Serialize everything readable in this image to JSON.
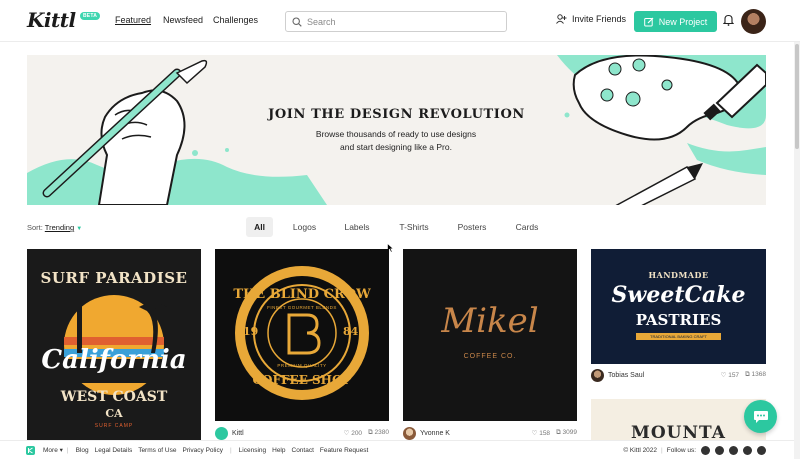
{
  "header": {
    "logo_text": "Kittl",
    "logo_badge": "BETA",
    "nav": [
      "Featured",
      "Newsfeed",
      "Challenges"
    ],
    "search_placeholder": "Search",
    "invite_label": "Invite Friends",
    "new_project_label": "New Project"
  },
  "banner": {
    "title": "JOIN THE DESIGN REVOLUTION",
    "subtitle_line1": "Browse thousands of ready to use designs",
    "subtitle_line2": "and start designing like a Pro.",
    "accent_color": "#8ee6cc"
  },
  "filters": {
    "sort_label": "Sort:",
    "sort_value": "Trending",
    "tabs": [
      "All",
      "Logos",
      "Labels",
      "T-Shirts",
      "Posters",
      "Cards"
    ],
    "active_tab": "All"
  },
  "cards": [
    {
      "art_title": "SURF PARADISE",
      "art_main": "California",
      "art_sub": "WEST COAST",
      "art_sub2": "CA",
      "art_foot": "SURF CAMP"
    },
    {
      "art_title": "THE BLIND CROW",
      "art_ring": "FINEST GOURMET BLENDS",
      "art_left": "19",
      "art_right": "84",
      "art_foot": "COFFEE SHOP",
      "art_mini": "PREMIUM QUALITY",
      "author": "Kittl",
      "likes": "200",
      "copies": "2380"
    },
    {
      "art_main": "Mikel",
      "art_sub": "COFFEE CO.",
      "author": "Yvonne K",
      "likes": "158",
      "copies": "3099"
    },
    {
      "art_top": "HANDMADE",
      "art_main": "SweetCake",
      "art_sub": "PASTRIES",
      "art_ribbon": "TRADITIONAL BAKING CRAFT",
      "author": "Tobias Saul",
      "likes": "157",
      "copies": "1368"
    },
    {
      "art_main": "MOUNTA"
    }
  ],
  "footer": {
    "more": "More",
    "links": [
      "Blog",
      "Legal Details",
      "Terms of Use",
      "Privacy Policy",
      "Licensing",
      "Help",
      "Contact",
      "Feature Request"
    ],
    "copyright": "© Kittl 2022",
    "follow": "Follow us:"
  }
}
